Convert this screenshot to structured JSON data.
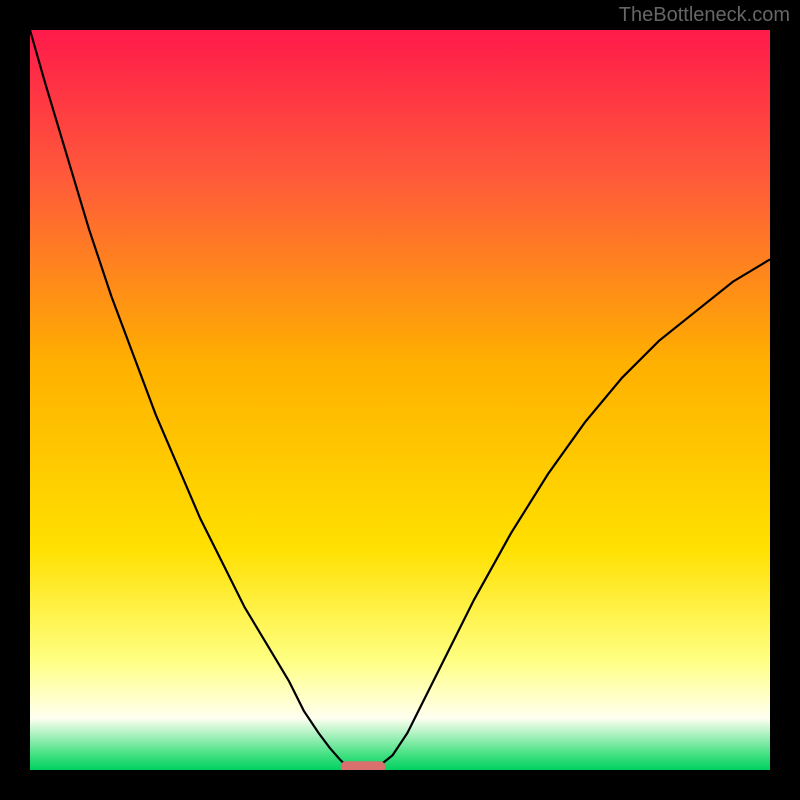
{
  "watermark": "TheBottleneck.com",
  "chart_data": {
    "type": "line",
    "title": "",
    "xlabel": "",
    "ylabel": "",
    "xlim": [
      0,
      100
    ],
    "ylim": [
      0,
      100
    ],
    "background_gradient": {
      "stops": [
        {
          "offset": 0.0,
          "color": "#ff1a4a"
        },
        {
          "offset": 0.2,
          "color": "#ff5a3a"
        },
        {
          "offset": 0.45,
          "color": "#ffb000"
        },
        {
          "offset": 0.7,
          "color": "#ffe000"
        },
        {
          "offset": 0.85,
          "color": "#ffff80"
        },
        {
          "offset": 0.93,
          "color": "#fffff0"
        },
        {
          "offset": 0.98,
          "color": "#40e080"
        },
        {
          "offset": 1.0,
          "color": "#00d060"
        }
      ]
    },
    "curve_left": {
      "x": [
        0,
        2,
        5,
        8,
        11,
        14,
        17,
        20,
        23,
        26,
        29,
        32,
        35,
        37,
        39,
        40.5,
        41.8,
        42.5
      ],
      "y": [
        100,
        93,
        83,
        73,
        64,
        56,
        48,
        41,
        34,
        28,
        22,
        17,
        12,
        8,
        5,
        3,
        1.5,
        0.8
      ]
    },
    "curve_right": {
      "x": [
        47.5,
        49,
        51,
        53,
        56,
        60,
        65,
        70,
        75,
        80,
        85,
        90,
        95,
        100
      ],
      "y": [
        0.8,
        2,
        5,
        9,
        15,
        23,
        32,
        40,
        47,
        53,
        58,
        62,
        66,
        69
      ]
    },
    "marker": {
      "x_center": 45,
      "width": 6,
      "y": 0.5,
      "color": "#d9706e"
    }
  }
}
